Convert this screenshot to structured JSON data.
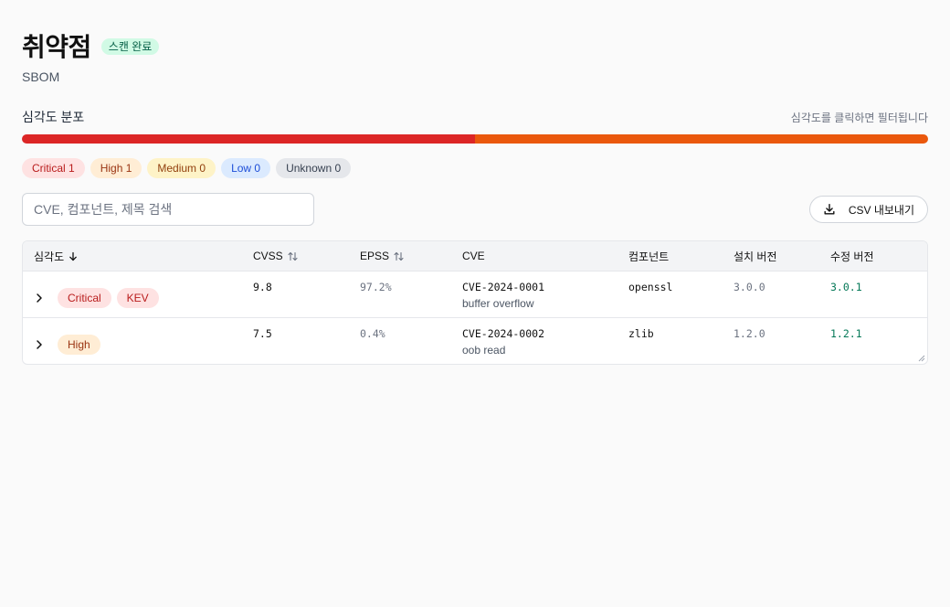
{
  "header": {
    "title": "취약점",
    "status_badge": "스캔 완료",
    "subtitle": "SBOM"
  },
  "distribution": {
    "title": "심각도 분포",
    "hint": "심각도를 클릭하면 필터됩니다",
    "segments": [
      {
        "name": "Critical",
        "count": 1,
        "color": "#dc2626"
      },
      {
        "name": "High",
        "count": 1,
        "color": "#ea580c"
      }
    ],
    "chips": [
      {
        "label": "Critical 1",
        "bg": "#fee2e2",
        "fg": "#b91c1c"
      },
      {
        "label": "High 1",
        "bg": "#ffedd5",
        "fg": "#9a3412"
      },
      {
        "label": "Medium 0",
        "bg": "#fef3c7",
        "fg": "#92400e"
      },
      {
        "label": "Low 0",
        "bg": "#dbeafe",
        "fg": "#1d4ed8"
      },
      {
        "label": "Unknown 0",
        "bg": "#e5e7eb",
        "fg": "#374151"
      }
    ]
  },
  "toolbar": {
    "search_placeholder": "CVE, 컴포넌트, 제목 검색",
    "search_value": "",
    "export_label": "CSV 내보내기"
  },
  "table": {
    "columns": {
      "severity": "심각도",
      "cvss": "CVSS",
      "epss": "EPSS",
      "cve": "CVE",
      "component": "컴포넌트",
      "installed": "설치 버전",
      "fixed": "수정 버전"
    },
    "rows": [
      {
        "severity": "Critical",
        "severity_bg": "#fee2e2",
        "severity_fg": "#b91c1c",
        "kev": "KEV",
        "cvss": "9.8",
        "epss": "97.2%",
        "cve": "CVE-2024-0001",
        "title": "buffer overflow",
        "component": "openssl",
        "installed": "3.0.0",
        "fixed": "3.0.1"
      },
      {
        "severity": "High",
        "severity_bg": "#ffedd5",
        "severity_fg": "#9a3412",
        "kev": "",
        "cvss": "7.5",
        "epss": "0.4%",
        "cve": "CVE-2024-0002",
        "title": "oob read",
        "component": "zlib",
        "installed": "1.2.0",
        "fixed": "1.2.1"
      }
    ]
  }
}
